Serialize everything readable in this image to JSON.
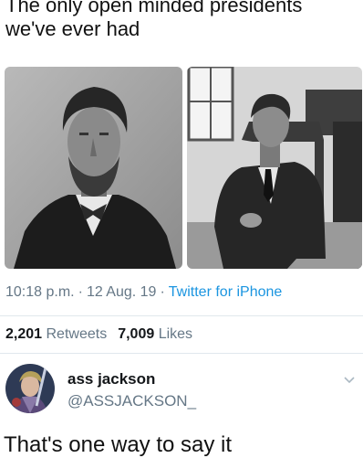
{
  "tweet": {
    "text": "The only open minded presidents\nwe've ever had",
    "time": "10:18 p.m.",
    "date": "12 Aug. 19",
    "separator": "·",
    "source": "Twitter for iPhone",
    "retweets_count": "2,201",
    "retweets_label": "Retweets",
    "likes_count": "7,009",
    "likes_label": "Likes",
    "images": [
      {
        "icon": "portrait-photo"
      },
      {
        "icon": "seated-portrait-photo"
      }
    ]
  },
  "reply": {
    "display_name": "ass jackson",
    "handle": "@ASSJACKSON_",
    "text": "That's one way to say it",
    "avatar_icon": "avatar-image",
    "menu_icon": "chevron-down-icon"
  },
  "colors": {
    "secondary_text": "#657786",
    "link": "#1b95e0",
    "divider": "#e1e8ed"
  }
}
